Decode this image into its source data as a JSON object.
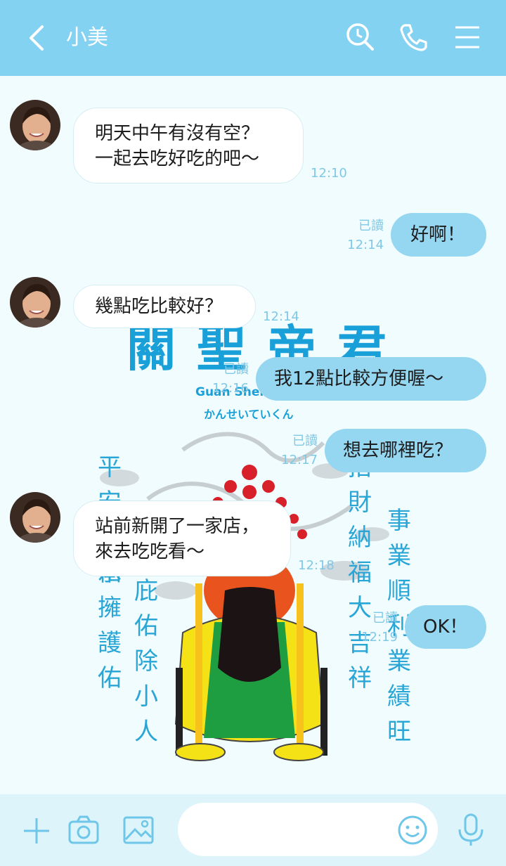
{
  "header": {
    "title": "小美",
    "back_icon": "chevron-left-icon",
    "search_icon": "search-clock-icon",
    "call_icon": "phone-icon",
    "menu_icon": "menu-icon"
  },
  "background": {
    "title": "關聖帝君",
    "subtitle_romaji": "Guan Sheng",
    "subtitle_kana": "かんせいていくん",
    "col1": "平安",
    "col2": "保佑",
    "col3": "承擁護佑",
    "col4": "庇佑除小人",
    "col5": "招財納福大吉祥",
    "col6": "事業順利業績旺"
  },
  "messages": [
    {
      "side": "left",
      "text": "明天中午有沒有空？\n一起去吃好吃的吧～",
      "time": "12:10"
    },
    {
      "side": "right",
      "text": "好啊！",
      "read": "已讀",
      "time": "12:14"
    },
    {
      "side": "left",
      "text": "幾點吃比較好？",
      "time": "12:14"
    },
    {
      "side": "right",
      "text": "我12點比較方便喔～",
      "read": "已讀",
      "time": "12:16"
    },
    {
      "side": "right",
      "text": "想去哪裡吃？",
      "read": "已讀",
      "time": "12:17"
    },
    {
      "side": "left",
      "text": "站前新開了一家店，\n來去吃吃看～",
      "time": "12:18"
    },
    {
      "side": "right",
      "text": "OK！",
      "read": "已讀",
      "time": "12:19"
    }
  ],
  "bottom": {
    "add_icon": "plus-icon",
    "camera_icon": "camera-icon",
    "image_icon": "image-icon",
    "input_placeholder": "",
    "emoji_icon": "emoji-icon",
    "mic_icon": "microphone-icon"
  },
  "colors": {
    "header": "#84d2f2",
    "background": "#f1fcfe",
    "right_bubble": "#95d6f1",
    "accent": "#1aa0d8"
  }
}
